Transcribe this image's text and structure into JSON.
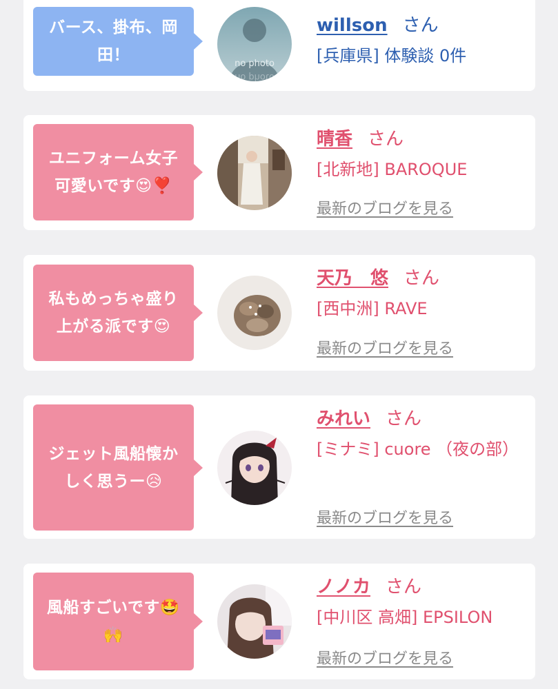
{
  "cards": [
    {
      "comment": "バース、掛布、岡\n田！",
      "name": "willson",
      "honorific": "さん",
      "detail": "[兵庫県] 体験談 0件",
      "avatar_text": "no photo",
      "avatar_reflect": "no photo",
      "theme": "blue"
    },
    {
      "comment": "ユニフォーム女子\n可愛いです😍❣️",
      "name": "晴香",
      "honorific": "さん",
      "detail": "[北新地] BAROQUE",
      "link": "最新のブログを見る",
      "theme": "pink"
    },
    {
      "comment": "私もめっちゃ盛り\n上がる派です😍",
      "name": "天乃　悠",
      "honorific": "さん",
      "detail": "[西中洲] RAVE",
      "link": "最新のブログを見る",
      "theme": "pink"
    },
    {
      "comment": "ジェット風船懐か\nしく思うー😥",
      "name": "みれい",
      "honorific": "さん",
      "detail": "[ミナミ] cuore （夜の部）",
      "link": "最新のブログを見る",
      "theme": "pink"
    },
    {
      "comment": "風船すごいです🤩\n🙌",
      "name": "ノノカ",
      "honorific": "さん",
      "detail": "[中川区 高畑] EPSILON",
      "link": "最新のブログを見る",
      "theme": "pink"
    }
  ],
  "colors": {
    "bubble_blue": "#8db4f2",
    "bubble_pink": "#f08ea2",
    "name_blue": "#2d5fb0",
    "name_pink": "#e0506e",
    "link_gray": "#8a8a8a",
    "page_bg": "#f0f0f2"
  }
}
